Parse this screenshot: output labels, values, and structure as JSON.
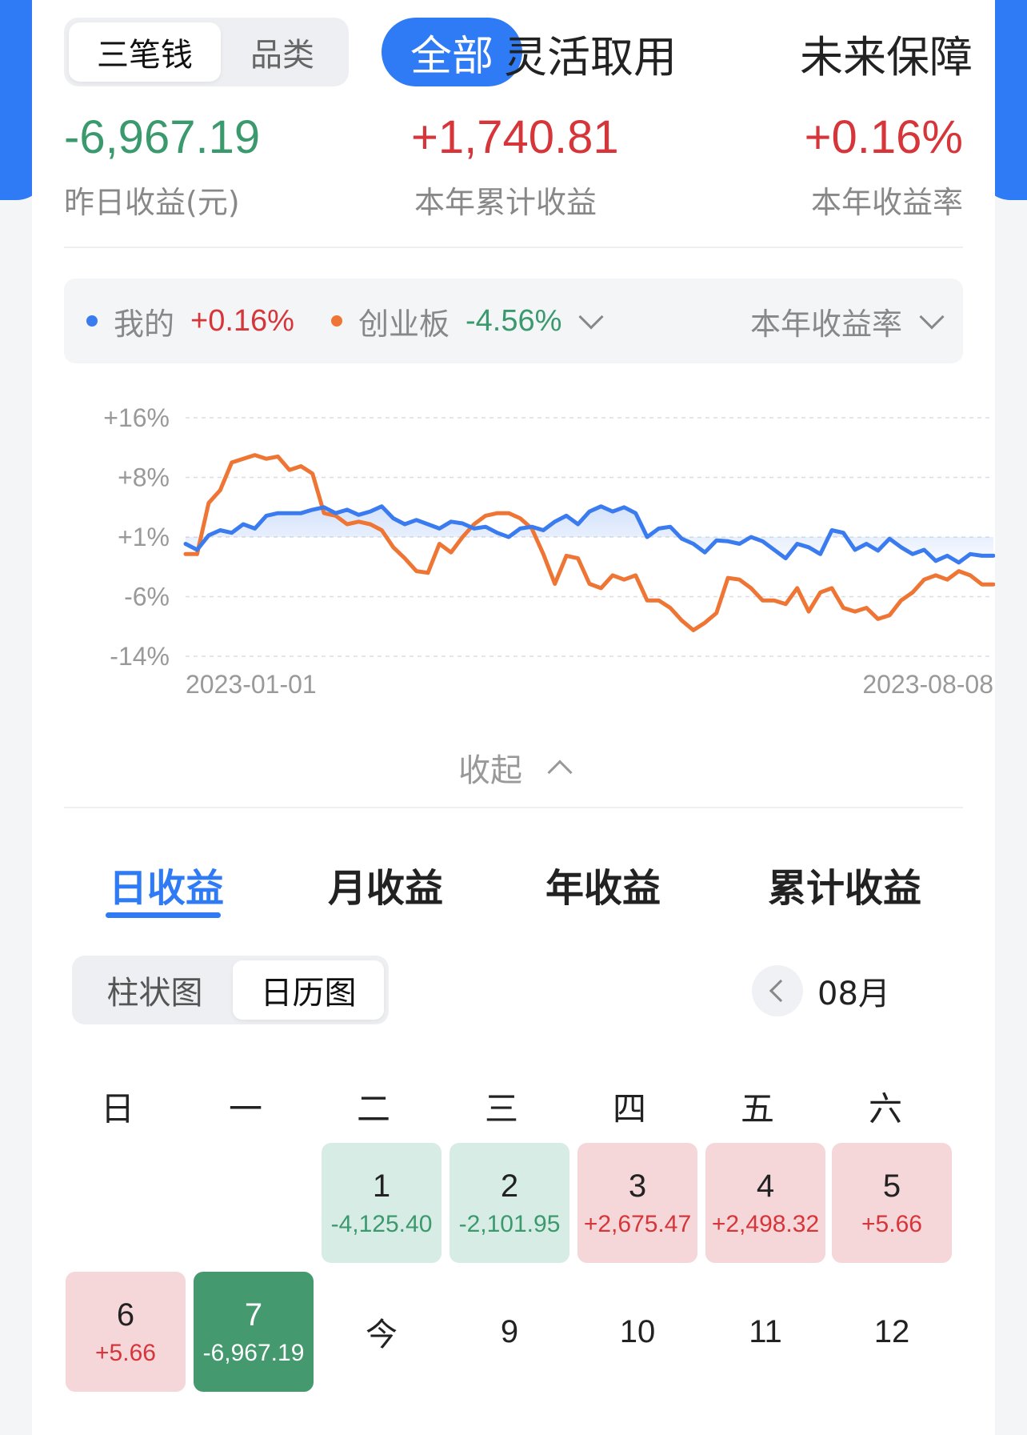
{
  "nav": {
    "segment": [
      "三笔钱",
      "品类"
    ],
    "tabs": [
      "全部",
      "灵活取用",
      "未来保障"
    ]
  },
  "stats": [
    {
      "value": "-6,967.19",
      "label": "昨日收益(元)"
    },
    {
      "value": "+1,740.81",
      "label": "本年累计收益"
    },
    {
      "value": "+0.16%",
      "label": "本年收益率"
    }
  ],
  "legend": {
    "mine_name": "我的",
    "mine_value": "+0.16%",
    "bench_name": "创业板",
    "bench_value": "-4.56%",
    "metric": "本年收益率"
  },
  "colors": {
    "accent": "#2f7bf5",
    "mine": "#3b7bf0",
    "bench": "#ef7535",
    "gain": "#d6353a",
    "loss": "#3a9a6d"
  },
  "chart_data": {
    "type": "line",
    "ylim": [
      -14,
      16
    ],
    "yticks": [
      "+16%",
      "+8%",
      "+1%",
      "-6%",
      "-14%"
    ],
    "ytick_values": [
      16,
      8,
      1,
      -6,
      -14
    ],
    "x_start": "2023-01-01",
    "x_end": "2023-08-08",
    "series": [
      {
        "name": "我的",
        "values": [
          0.2,
          -0.5,
          1.2,
          1.8,
          1.5,
          2.5,
          2.0,
          3.5,
          3.8,
          3.8,
          3.8,
          4.2,
          4.5,
          3.8,
          4.2,
          3.6,
          4.0,
          4.6,
          3.2,
          2.5,
          3.0,
          2.5,
          2.0,
          2.8,
          2.6,
          2.0,
          2.2,
          1.5,
          1.0,
          2.0,
          2.2,
          1.8,
          2.8,
          3.5,
          2.5,
          4.0,
          4.6,
          4.0,
          4.5,
          3.8,
          1.0,
          2.0,
          2.2,
          0.8,
          0.2,
          -0.8,
          0.6,
          0.5,
          0.2,
          1.0,
          0.5,
          -0.5,
          -1.5,
          0.2,
          -0.2,
          -1.0,
          1.8,
          1.5,
          -0.5,
          0.2,
          -0.6,
          0.8,
          -0.2,
          -1.0,
          -0.5,
          -1.8,
          -1.2,
          -2.0,
          -1.0,
          -1.2,
          -1.2
        ]
      },
      {
        "name": "创业板",
        "values": [
          -1.0,
          -1.0,
          5.0,
          6.5,
          10.0,
          10.5,
          11.0,
          10.5,
          10.8,
          9.0,
          9.5,
          8.5,
          3.8,
          3.5,
          2.5,
          2.8,
          2.5,
          1.8,
          -0.2,
          -1.5,
          -3.0,
          -3.2,
          0.2,
          -0.8,
          1.0,
          2.5,
          3.5,
          3.8,
          3.8,
          3.2,
          2.0,
          -1.0,
          -4.5,
          -1.2,
          -1.5,
          -4.5,
          -5.0,
          -3.5,
          -4.0,
          -3.5,
          -6.5,
          -6.5,
          -7.5,
          -9.2,
          -10.5,
          -9.5,
          -8.2,
          -3.8,
          -4.0,
          -5.0,
          -6.5,
          -6.5,
          -7.0,
          -5.0,
          -8.0,
          -5.5,
          -5.0,
          -7.5,
          -8.0,
          -7.5,
          -9.0,
          -8.5,
          -6.5,
          -5.5,
          -4.0,
          -3.5,
          -4.0,
          -3.0,
          -3.5,
          -4.56,
          -4.56
        ]
      }
    ],
    "grid": true
  },
  "collapse_label": "收起",
  "tabs2": [
    "日收益",
    "月收益",
    "年收益",
    "累计收益"
  ],
  "view_toggle": [
    "柱状图",
    "日历图"
  ],
  "month": "08月",
  "weekdays": [
    "日",
    "一",
    "二",
    "三",
    "四",
    "五",
    "六"
  ],
  "calendar": {
    "d1": {
      "num": "1",
      "amt": "-4,125.40"
    },
    "d2": {
      "num": "2",
      "amt": "-2,101.95"
    },
    "d3": {
      "num": "3",
      "amt": "+2,675.47"
    },
    "d4": {
      "num": "4",
      "amt": "+2,498.32"
    },
    "d5": {
      "num": "5",
      "amt": "+5.66"
    },
    "d6": {
      "num": "6",
      "amt": "+5.66"
    },
    "d7": {
      "num": "7",
      "amt": "-6,967.19"
    },
    "d8": {
      "num": "今"
    },
    "d9": {
      "num": "9"
    },
    "d10": {
      "num": "10"
    },
    "d11": {
      "num": "11"
    },
    "d12": {
      "num": "12"
    }
  }
}
